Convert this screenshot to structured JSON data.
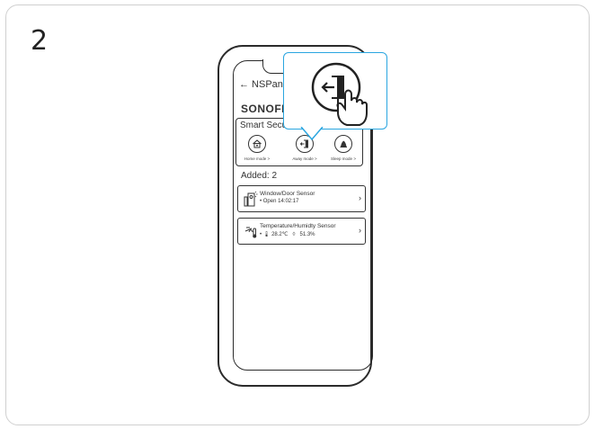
{
  "step": "2",
  "app": {
    "back_title": "← NSPane",
    "brand": "SONOFF",
    "security": {
      "title": "Smart Secur",
      "modes": [
        {
          "label": "Home mode >",
          "icon": "home-icon"
        },
        {
          "label": "Away mode >",
          "icon": "exit-door-icon"
        },
        {
          "label": "Sleep mode >",
          "icon": "sleep-icon"
        }
      ]
    },
    "added_label": "Added: 2",
    "sensors": [
      {
        "name": "Window/Door Sensor",
        "status": "• Open 14:02:17",
        "icon": "door-sensor-icon"
      },
      {
        "name": "Temperature/Humidty Sensor",
        "temp": "28.2℃",
        "humidity": "51.3%",
        "icon": "temp-humidity-icon"
      }
    ]
  },
  "callout": {
    "icon": "exit-door-icon",
    "accent_color": "#2aa6e0"
  }
}
